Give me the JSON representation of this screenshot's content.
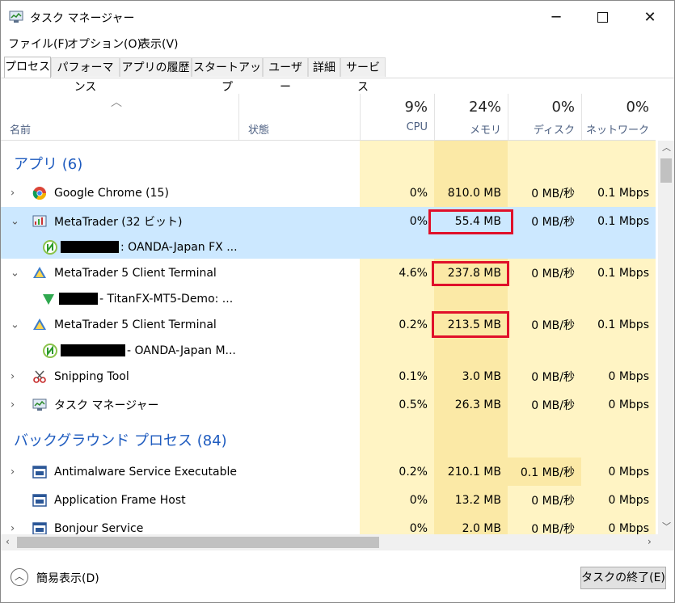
{
  "window": {
    "title": "タスク マネージャー"
  },
  "menu": [
    "ファイル(F)",
    "オプション(O)",
    "表示(V)"
  ],
  "tabs": [
    "プロセス",
    "パフォーマンス",
    "アプリの履歴",
    "スタートアップ",
    "ユーザー",
    "詳細",
    "サービス"
  ],
  "header": {
    "name": "名前",
    "status": "状態",
    "cpu": {
      "pct": "9%",
      "label": "CPU"
    },
    "memory": {
      "pct": "24%",
      "label": "メモリ"
    },
    "disk": {
      "pct": "0%",
      "label": "ディスク"
    },
    "network": {
      "pct": "0%",
      "label": "ネットワーク"
    }
  },
  "groups": {
    "apps": "アプリ (6)",
    "background": "バックグラウンド プロセス (84)"
  },
  "rows": [
    {
      "name": "Google Chrome (15)",
      "cpu": "0%",
      "mem": "810.0 MB",
      "disk": "0 MB/秒",
      "net": "0.1 Mbps"
    },
    {
      "name": "MetaTrader (32 ビット)",
      "cpu": "0%",
      "mem": "55.4 MB",
      "disk": "0 MB/秒",
      "net": "0.1 Mbps"
    },
    {
      "name": ": OANDA-Japan FX ..."
    },
    {
      "name": "MetaTrader 5 Client Terminal",
      "cpu": "4.6%",
      "mem": "237.8 MB",
      "disk": "0 MB/秒",
      "net": "0.1 Mbps"
    },
    {
      "name": "- TitanFX-MT5-Demo: ..."
    },
    {
      "name": "MetaTrader 5 Client Terminal",
      "cpu": "0.2%",
      "mem": "213.5 MB",
      "disk": "0 MB/秒",
      "net": "0.1 Mbps"
    },
    {
      "name": "- OANDA-Japan M..."
    },
    {
      "name": "Snipping Tool",
      "cpu": "0.1%",
      "mem": "3.0 MB",
      "disk": "0 MB/秒",
      "net": "0 Mbps"
    },
    {
      "name": "タスク マネージャー",
      "cpu": "0.5%",
      "mem": "26.3 MB",
      "disk": "0 MB/秒",
      "net": "0 Mbps"
    },
    {
      "name": "Antimalware Service Executable",
      "cpu": "0.2%",
      "mem": "210.1 MB",
      "disk": "0.1 MB/秒",
      "net": "0 Mbps"
    },
    {
      "name": "Application Frame Host",
      "cpu": "0%",
      "mem": "13.2 MB",
      "disk": "0 MB/秒",
      "net": "0 Mbps"
    },
    {
      "name": "Bonjour Service",
      "cpu": "0%",
      "mem": "2.0 MB",
      "disk": "0 MB/秒",
      "net": "0 Mbps"
    }
  ],
  "footer": {
    "fewer": "簡易表示(D)",
    "end_task": "タスクの終了(E)"
  },
  "icons": {
    "expand": "chevron-right-icon",
    "collapse": "chevron-down-icon",
    "sort": "sort-up-icon"
  }
}
